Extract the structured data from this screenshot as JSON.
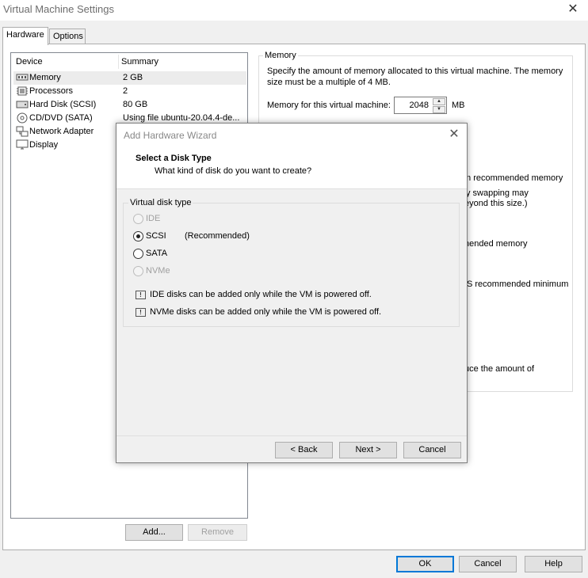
{
  "window": {
    "title": "Virtual Machine Settings",
    "tabs": [
      "Hardware",
      "Options"
    ]
  },
  "device_list": {
    "columns": [
      "Device",
      "Summary"
    ],
    "rows": [
      {
        "device": "Memory",
        "summary": "2 GB",
        "icon": "memory-icon"
      },
      {
        "device": "Processors",
        "summary": "2",
        "icon": "processor-icon"
      },
      {
        "device": "Hard Disk (SCSI)",
        "summary": "80 GB",
        "icon": "hard-disk-icon"
      },
      {
        "device": "CD/DVD (SATA)",
        "summary": "Using file ubuntu-20.04.4-de...",
        "icon": "cd-dvd-icon"
      },
      {
        "device": "Network Adapter",
        "summary": "",
        "icon": "network-adapter-icon"
      },
      {
        "device": "Display",
        "summary": "",
        "icon": "display-icon"
      }
    ],
    "add_label": "Add...",
    "remove_label": "Remove"
  },
  "memory_panel": {
    "group_label": "Memory",
    "description": "Specify the amount of memory allocated to this virtual machine. The memory size must be a multiple of 4 MB.",
    "field_label": "Memory for this virtual machine:",
    "value": "2048",
    "unit": "MB",
    "partial_texts": [
      "m recommended memory",
      "y swapping may",
      "eyond this size.)",
      "nended memory",
      "S recommended minimum",
      "uce the amount of"
    ]
  },
  "footer": {
    "ok": "OK",
    "cancel": "Cancel",
    "help": "Help"
  },
  "wizard": {
    "title": "Add Hardware Wizard",
    "heading": "Select a Disk Type",
    "subheading": "What kind of disk do you want to create?",
    "group_label": "Virtual disk type",
    "options": [
      {
        "label": "IDE",
        "checked": false,
        "enabled": false,
        "note": ""
      },
      {
        "label": "SCSI",
        "checked": true,
        "enabled": true,
        "note": "(Recommended)"
      },
      {
        "label": "SATA",
        "checked": false,
        "enabled": true,
        "note": ""
      },
      {
        "label": "NVMe",
        "checked": false,
        "enabled": false,
        "note": ""
      }
    ],
    "info": [
      "IDE disks can be added only while the VM is powered off.",
      "NVMe disks can be added only while the VM is powered off."
    ],
    "back_label": "< Back",
    "next_label": "Next >",
    "cancel_label": "Cancel"
  },
  "colors": {
    "accent": "#0078d7",
    "selection": "#ececec",
    "disabled_text": "#a0a0a0"
  }
}
